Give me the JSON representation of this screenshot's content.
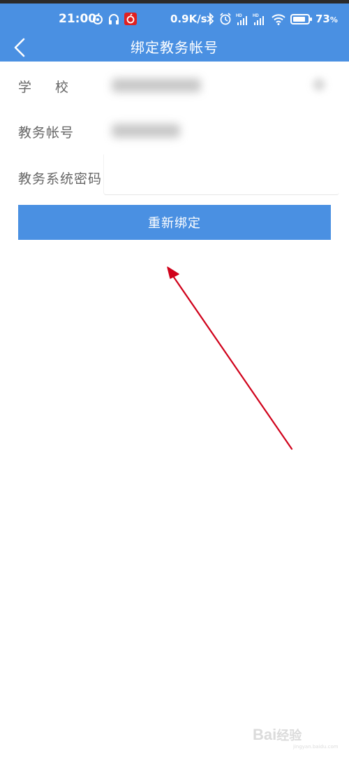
{
  "status_bar": {
    "time": "21:00",
    "network_speed": "0.9K/s",
    "battery_percent": "73",
    "battery_unit": "%",
    "icons": [
      "app-notification-icon",
      "headset-icon",
      "netease-music-icon",
      "bluetooth-icon",
      "alarm-icon",
      "signal-hd-icon",
      "signal-hd-icon",
      "wifi-icon",
      "battery-icon"
    ]
  },
  "nav": {
    "title": "绑定教务帐号",
    "back_icon": "chevron-left-icon"
  },
  "form": {
    "school_label": "学校",
    "account_label": "教务帐号",
    "password_label": "教务系统密码"
  },
  "button": {
    "rebind_label": "重新绑定"
  },
  "watermark": {
    "text": "Bai",
    "suffix": "经验",
    "url": "jingyan.baidu.com"
  },
  "colors": {
    "primary": "#4a90e2",
    "annotation_arrow": "#d0021b"
  }
}
